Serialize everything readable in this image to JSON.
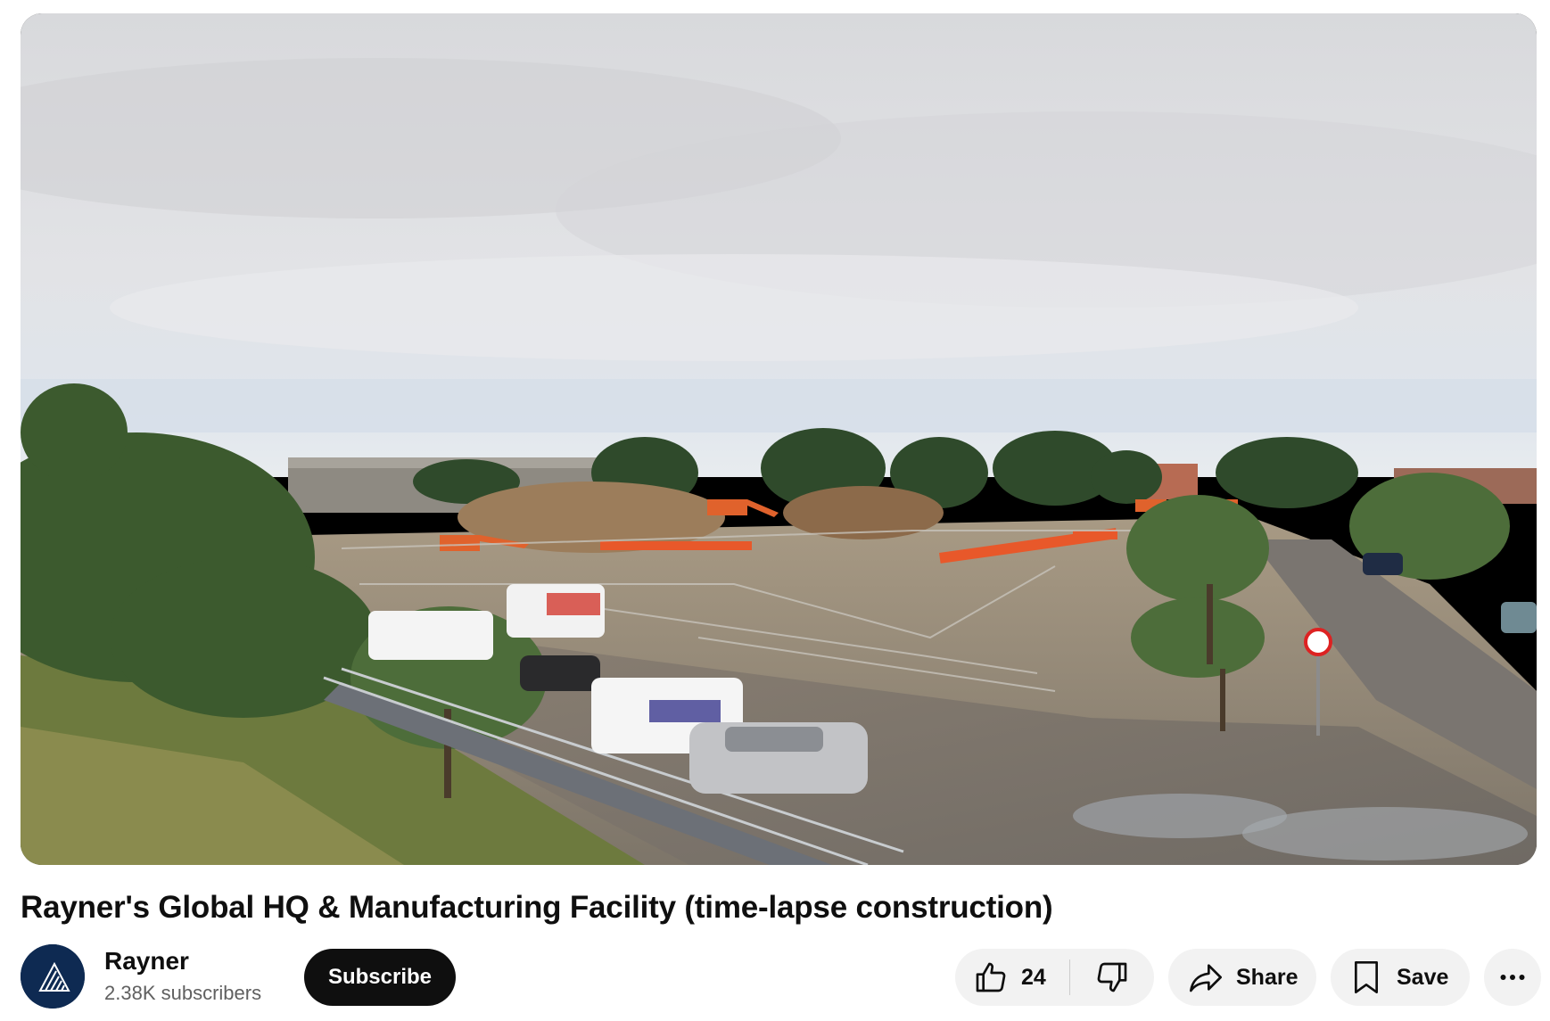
{
  "video": {
    "title": "Rayner's Global HQ & Manufacturing Facility (time-lapse construction)",
    "thumbnail_icon": "construction-site-timelapse-frame"
  },
  "channel": {
    "name": "Rayner",
    "subscribers": "2.38K subscribers",
    "avatar_icon": "rayner-logo-icon"
  },
  "actions": {
    "subscribe_label": "Subscribe",
    "like_count": "24",
    "share_label": "Share",
    "save_label": "Save",
    "like_icon": "thumbs-up-icon",
    "dislike_icon": "thumbs-down-icon",
    "share_icon": "share-arrow-icon",
    "save_icon": "bookmark-icon",
    "more_icon": "more-horizontal-icon"
  },
  "colors": {
    "subscribe_bg": "#0f0f0f",
    "pill_bg": "#f2f2f2",
    "avatar_bg": "#0e2a52",
    "secondary_text": "#606060"
  }
}
